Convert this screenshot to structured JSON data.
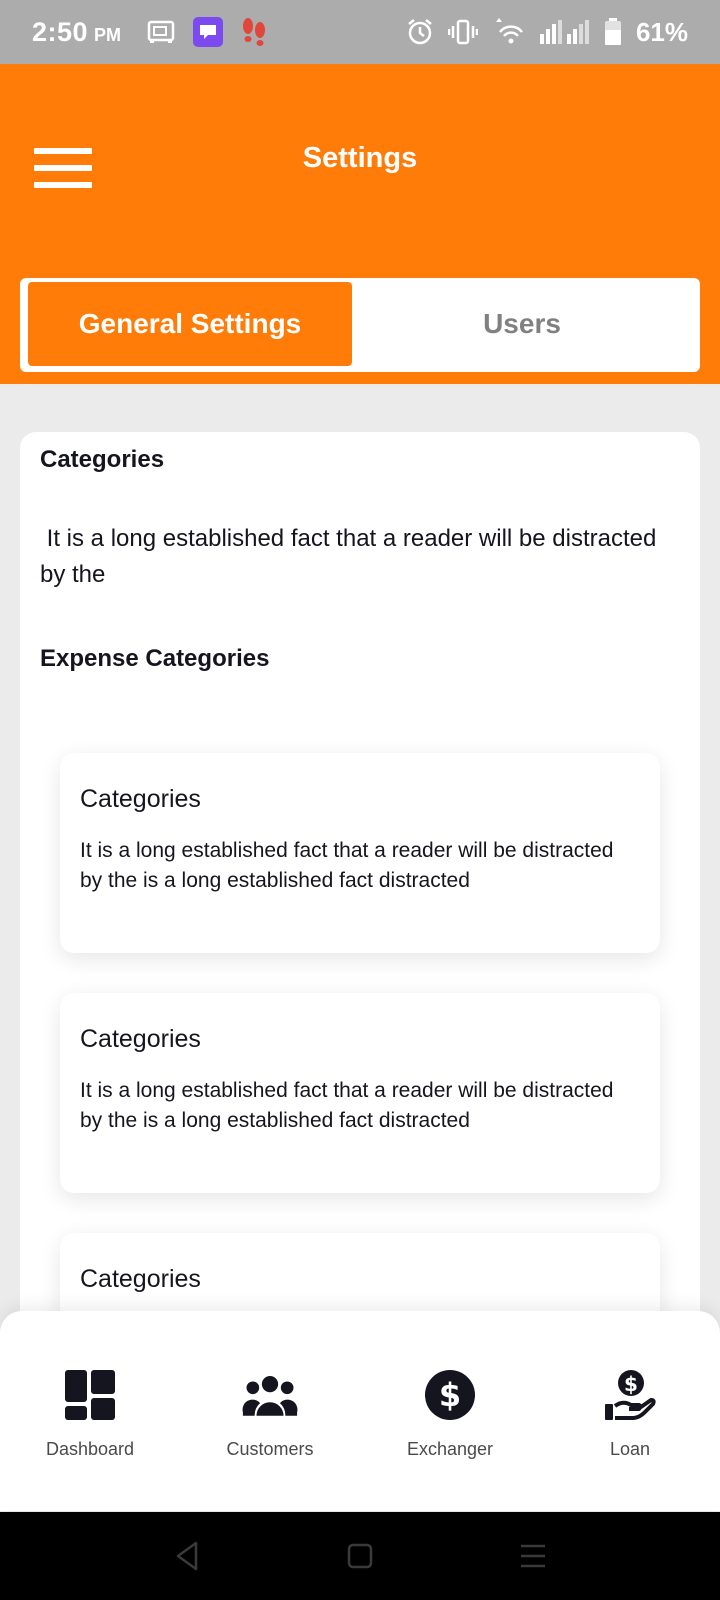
{
  "status_bar": {
    "time": "2:50",
    "ampm": "PM",
    "battery_percent": "61%",
    "left_icons": [
      "cash-register-icon",
      "chat-app-icon",
      "footsteps-icon"
    ],
    "right_icons": [
      "alarm-icon",
      "vibrate-icon",
      "wifi-icon",
      "signal-icon",
      "battery-icon"
    ]
  },
  "header": {
    "title": "Settings",
    "background_color": "#ff7c09"
  },
  "tabs": [
    {
      "label": "General Settings",
      "active": true
    },
    {
      "label": "Users",
      "active": false
    }
  ],
  "main": {
    "categories_heading": "Categories",
    "categories_desc": " It is a long established fact that a reader will be distracted by the",
    "expense_heading": "Expense Categories",
    "items": [
      {
        "title": "Categories",
        "desc": "It is a long established fact that a reader will be distracted by the is a long established fact distracted"
      },
      {
        "title": "Categories",
        "desc": "It is a long established fact that a reader will be distracted by the is a long established fact distracted"
      },
      {
        "title": "Categories",
        "desc": ""
      }
    ]
  },
  "bottom_nav": [
    {
      "label": "Dashboard",
      "icon": "dashboard-icon"
    },
    {
      "label": "Customers",
      "icon": "customers-icon"
    },
    {
      "label": "Exchanger",
      "icon": "dollar-coin-icon"
    },
    {
      "label": "Loan",
      "icon": "loan-hand-icon"
    }
  ],
  "system_nav": [
    "back-icon",
    "home-icon",
    "recents-icon"
  ]
}
